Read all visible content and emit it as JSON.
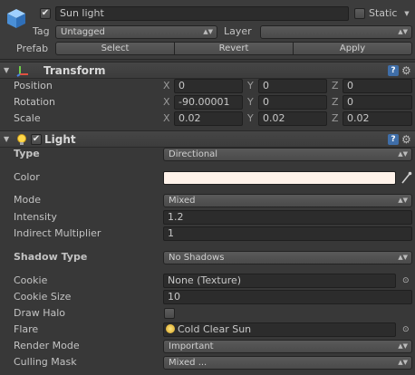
{
  "header": {
    "object_active": true,
    "name": "Sun light",
    "static_label": "Static",
    "static_checked": false,
    "tag_label": "Tag",
    "tag_value": "Untagged",
    "layer_label": "Layer",
    "layer_value": "",
    "prefab_label": "Prefab",
    "select_label": "Select",
    "revert_label": "Revert",
    "apply_label": "Apply"
  },
  "transform": {
    "title": "Transform",
    "position_label": "Position",
    "rotation_label": "Rotation",
    "scale_label": "Scale",
    "axis_x": "X",
    "axis_y": "Y",
    "axis_z": "Z",
    "position": {
      "x": "0",
      "y": "0",
      "z": "0"
    },
    "rotation": {
      "x": "-90.00001",
      "y": "0",
      "z": "0"
    },
    "scale": {
      "x": "0.02",
      "y": "0.02",
      "z": "0.02"
    }
  },
  "light": {
    "title": "Light",
    "enabled": true,
    "type_label": "Type",
    "type_value": "Directional",
    "color_label": "Color",
    "color_value": "#fff3ea",
    "mode_label": "Mode",
    "mode_value": "Mixed",
    "intensity_label": "Intensity",
    "intensity_value": "1.2",
    "indirect_label": "Indirect Multiplier",
    "indirect_value": "1",
    "shadow_type_label": "Shadow Type",
    "shadow_type_value": "No Shadows",
    "cookie_label": "Cookie",
    "cookie_value": "None (Texture)",
    "cookie_size_label": "Cookie Size",
    "cookie_size_value": "10",
    "draw_halo_label": "Draw Halo",
    "draw_halo_checked": false,
    "flare_label": "Flare",
    "flare_value": "Cold Clear Sun",
    "render_mode_label": "Render Mode",
    "render_mode_value": "Important",
    "culling_mask_label": "Culling Mask",
    "culling_mask_value": "Mixed ..."
  },
  "icons": {
    "gameobject": "cube-icon",
    "transform": "transform-axes-icon",
    "light": "lightbulb-icon",
    "help": "help-book-icon",
    "settings": "gear-icon",
    "picker": "object-picker-icon",
    "eyedropper": "eyedropper-icon"
  },
  "colors": {
    "background": "#383838",
    "field": "#2c2c2c",
    "accent_blue": "#3f6ea8"
  }
}
